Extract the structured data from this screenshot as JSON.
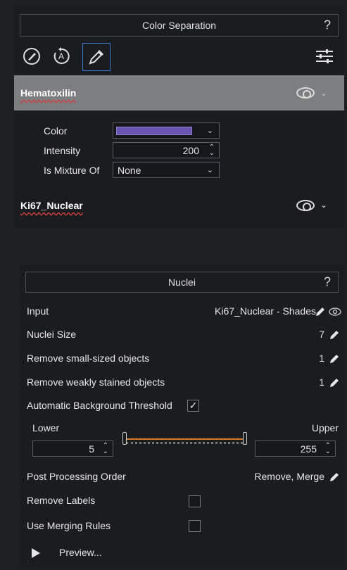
{
  "color_separation": {
    "title": "Color Separation",
    "help": "?",
    "toolbar": {
      "icons": [
        "brush-icon",
        "auto-icon",
        "eyedropper-icon",
        "sliders-icon"
      ],
      "auto_letter": "A"
    },
    "stains": [
      {
        "name": "Hematoxilin",
        "expanded": true,
        "properties": {
          "color_label": "Color",
          "color_value": "#6b55b3",
          "intensity_label": "Intensity",
          "intensity_value": "200",
          "mixture_label": "Is Mixture Of",
          "mixture_value": "None"
        }
      },
      {
        "name": "Ki67_Nuclear",
        "expanded": false
      }
    ]
  },
  "nuclei": {
    "title": "Nuclei",
    "help": "?",
    "input_label": "Input",
    "input_value": "Ki67_Nuclear - Shades",
    "nuclei_size_label": "Nuclei Size",
    "nuclei_size_value": "7",
    "remove_small_label": "Remove small-sized objects",
    "remove_small_value": "1",
    "remove_weak_label": "Remove weakly stained objects",
    "remove_weak_value": "1",
    "auto_bg_label": "Automatic Background Threshold",
    "auto_bg_checked": true,
    "check_glyph": "✓",
    "lower_label": "Lower",
    "upper_label": "Upper",
    "lower_value": "5",
    "upper_value": "255",
    "post_processing_label": "Post Processing Order",
    "post_processing_value": "Remove, Merge",
    "remove_labels_label": "Remove Labels",
    "remove_labels_checked": false,
    "merging_rules_label": "Use Merging Rules",
    "merging_rules_checked": false,
    "preview_label": "Preview..."
  },
  "colors": {
    "accent_orange": "#e07a20",
    "selected_header": "#7d7e80"
  }
}
